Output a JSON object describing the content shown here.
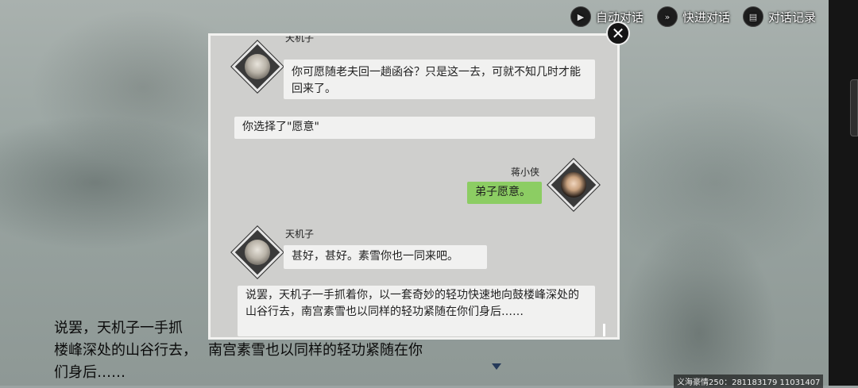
{
  "top_bar": {
    "auto_label": "自动对话",
    "fast_label": "快进对话",
    "log_label": "对话记录"
  },
  "dialog": {
    "messages": [
      {
        "speaker": "天机子",
        "text": "你可愿随老夫回一趟函谷？只是这一去，可就不知几时才能回来了。"
      },
      {
        "system": "你选择了\"愿意\""
      },
      {
        "speaker": "蒋小侠",
        "text": "弟子愿意。"
      },
      {
        "speaker": "天机子",
        "text": "甚好，甚好。素雪你也一同来吧。"
      },
      {
        "narration": "说罢，天机子一手抓着你，以一套奇妙的轻功快速地向鼓楼峰深处的山谷行去，南宫素雪也以同样的轻功紧随在你们身后……"
      }
    ]
  },
  "narration": {
    "left_text": "说罢，天机子一手抓\n楼峰深处的山谷行去，\n们身后……",
    "mid_text": "南宫素雪也以同样的轻功紧随在你"
  },
  "footer": {
    "server_info": "义海豪情250：281183179  11031407"
  },
  "colors": {
    "player_bubble": "#8ccd63",
    "npc_bubble": "#f1f1f0",
    "dialog_bg": "#cfcfcd"
  }
}
